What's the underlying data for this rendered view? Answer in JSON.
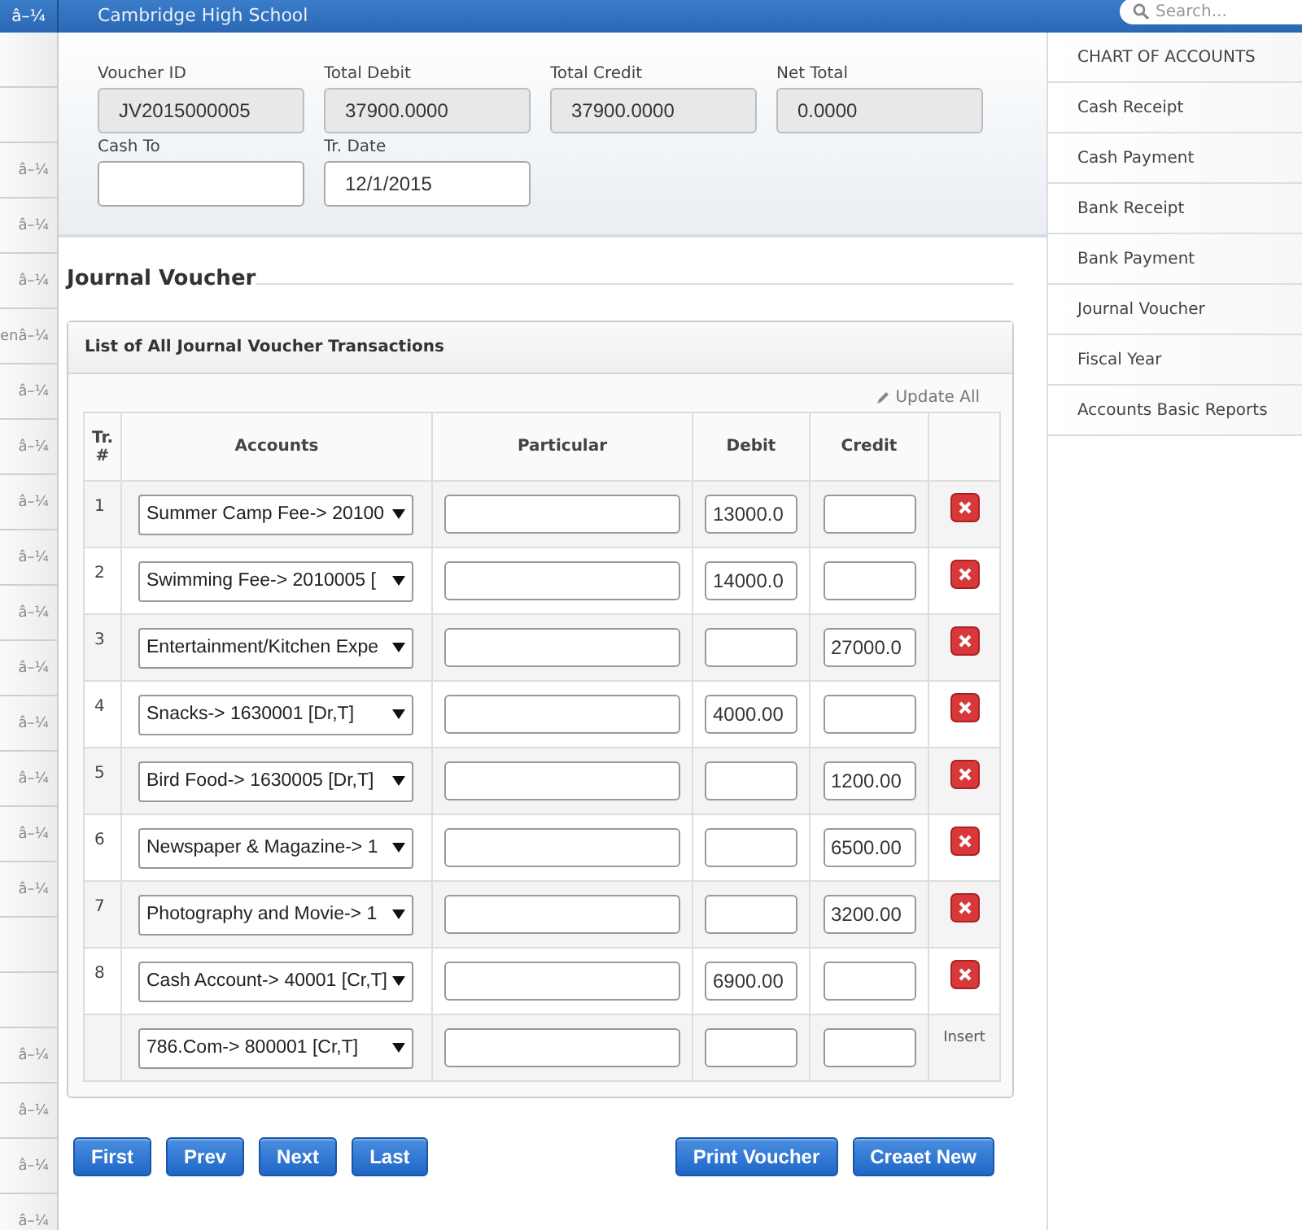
{
  "top_bar": {
    "rail_label": "â–¼",
    "title": "Cambridge High School",
    "search": {
      "placeholder": "Search..."
    }
  },
  "left_rail": {
    "items": [
      {
        "kind": "blank"
      },
      {
        "kind": "blank"
      },
      {
        "kind": "label",
        "label": "â–¼"
      },
      {
        "kind": "label",
        "label": "â–¼"
      },
      {
        "kind": "label",
        "label": "â–¼"
      },
      {
        "kind": "label",
        "label": "enâ–¼"
      },
      {
        "kind": "label",
        "label": "â–¼"
      },
      {
        "kind": "label",
        "label": "â–¼"
      },
      {
        "kind": "label",
        "label": "â–¼"
      },
      {
        "kind": "label",
        "label": "â–¼"
      },
      {
        "kind": "label",
        "label": "â–¼"
      },
      {
        "kind": "label",
        "label": "â–¼"
      },
      {
        "kind": "label",
        "label": "â–¼"
      },
      {
        "kind": "label",
        "label": "â–¼"
      },
      {
        "kind": "label",
        "label": "â–¼"
      },
      {
        "kind": "label",
        "label": "â–¼"
      },
      {
        "kind": "blank"
      },
      {
        "kind": "blank"
      },
      {
        "kind": "label",
        "label": "â–¼"
      },
      {
        "kind": "label",
        "label": "â–¼"
      },
      {
        "kind": "label",
        "label": "â–¼"
      },
      {
        "kind": "label",
        "label": "â–¼"
      }
    ]
  },
  "form": {
    "fields": [
      {
        "label": "Voucher ID",
        "value": "JV2015000005",
        "disabled": true
      },
      {
        "label": "Total Debit",
        "value": "37900.0000",
        "disabled": true
      },
      {
        "label": "Total Credit",
        "value": "37900.0000",
        "disabled": true
      },
      {
        "label": "Net Total",
        "value": "0.0000",
        "disabled": true
      },
      {
        "label": "Cash To",
        "disabled": false
      },
      {
        "label": "Tr. Date",
        "value": "12/1/2015",
        "disabled": false
      }
    ]
  },
  "section_title": "Journal Voucher",
  "panel": {
    "title": "List of All Journal Voucher Transactions",
    "update_all": "Update All",
    "columns": [
      "Tr. #",
      "Accounts",
      "Particular",
      "Debit",
      "Credit"
    ],
    "rows": [
      {
        "kind": "entry",
        "number": "1",
        "account": "Summer Camp Fee-> 20100",
        "debit": "13000.0"
      },
      {
        "kind": "entry",
        "number": "2",
        "account": "Swimming Fee-> 2010005 [",
        "debit": "14000.0"
      },
      {
        "kind": "entry",
        "number": "3",
        "account": "Entertainment/Kitchen Expe",
        "credit": "27000.0"
      },
      {
        "kind": "entry",
        "number": "4",
        "account": "Snacks-> 1630001 [Dr,T]",
        "debit": "4000.00"
      },
      {
        "kind": "entry",
        "number": "5",
        "account": "Bird Food-> 1630005 [Dr,T]",
        "credit": "1200.00"
      },
      {
        "kind": "entry",
        "number": "6",
        "account": "Newspaper & Magazine-> 1",
        "credit": "6500.00"
      },
      {
        "kind": "entry",
        "number": "7",
        "account": "Photography and Movie-> 1",
        "credit": "3200.00"
      },
      {
        "kind": "entry",
        "number": "8",
        "account": "Cash Account-> 40001 [Cr,T]",
        "debit": "6900.00"
      },
      {
        "kind": "new",
        "account": "786.Com-> 800001 [Cr,T]",
        "insert_label": "Insert"
      }
    ]
  },
  "pager": [
    "First",
    "Prev",
    "Next",
    "Last"
  ],
  "actions": [
    "Print Voucher",
    "Creaet New"
  ],
  "side_menu": [
    "CHART OF ACCOUNTS",
    "Cash Receipt",
    "Cash Payment",
    "Bank Receipt",
    "Bank Payment",
    "Journal Voucher",
    "Fiscal Year",
    "Accounts Basic Reports"
  ]
}
